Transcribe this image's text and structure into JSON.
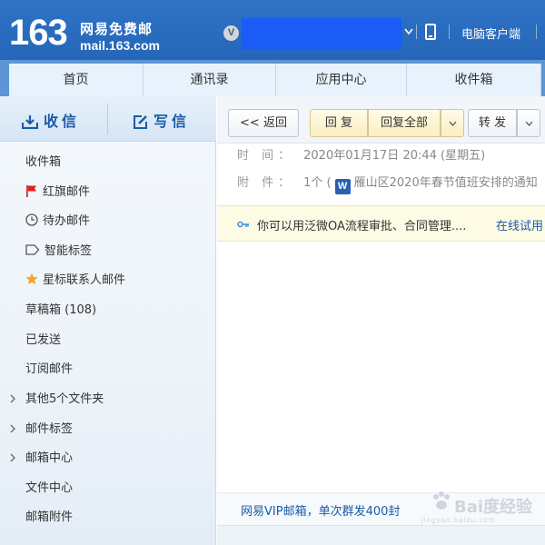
{
  "header": {
    "logo_number": "163",
    "logo_title": "网易免费邮",
    "logo_domain": "mail.163.com",
    "vip_badge": "V",
    "client_link": "电脑客户端",
    "accent_color": "#2566b8",
    "mask_color": "#1a5cf5"
  },
  "tabs": [
    {
      "label": "首页"
    },
    {
      "label": "通讯录"
    },
    {
      "label": "应用中心"
    },
    {
      "label": "收件箱"
    }
  ],
  "sidebar": {
    "receive_label": "收信",
    "compose_label": "写信",
    "folders": [
      {
        "label": "收件箱",
        "icon": "none"
      },
      {
        "label": "红旗邮件",
        "icon": "red-flag-icon"
      },
      {
        "label": "待办邮件",
        "icon": "clock-icon"
      },
      {
        "label": "智能标签",
        "icon": "tag-icon"
      },
      {
        "label": "星标联系人邮件",
        "icon": "star-icon"
      },
      {
        "label": "草稿箱 (108)",
        "icon": "none"
      },
      {
        "label": "已发送",
        "icon": "none"
      },
      {
        "label": "订阅邮件",
        "icon": "none"
      },
      {
        "label": "其他5个文件夹",
        "icon": "chevron-right-icon"
      },
      {
        "label": "邮件标签",
        "icon": "chevron-right-icon"
      },
      {
        "label": "邮箱中心",
        "icon": "chevron-right-icon"
      },
      {
        "label": "文件中心",
        "icon": "none"
      },
      {
        "label": "邮箱附件",
        "icon": "none"
      }
    ]
  },
  "toolbar": {
    "back_label": "<< 返回",
    "reply_label": "回 复",
    "reply_all_label": "回复全部",
    "forward_label": "转 发"
  },
  "message": {
    "time_label": "时 间：",
    "time_value": "2020年01月17日 20:44 (星期五)",
    "attach_label": "附 件：",
    "attach_count": "1个 (",
    "attach_name": "雁山区2020年春节值班安排的通知"
  },
  "ad": {
    "text": "你可以用泛微OA流程审批、合同管理....",
    "link": "在线试用"
  },
  "vip_promo": {
    "text": "网易VIP邮箱，单次群发400封"
  },
  "watermark": {
    "text": "Bai度经验",
    "url": "jingyan.baidu.com"
  }
}
